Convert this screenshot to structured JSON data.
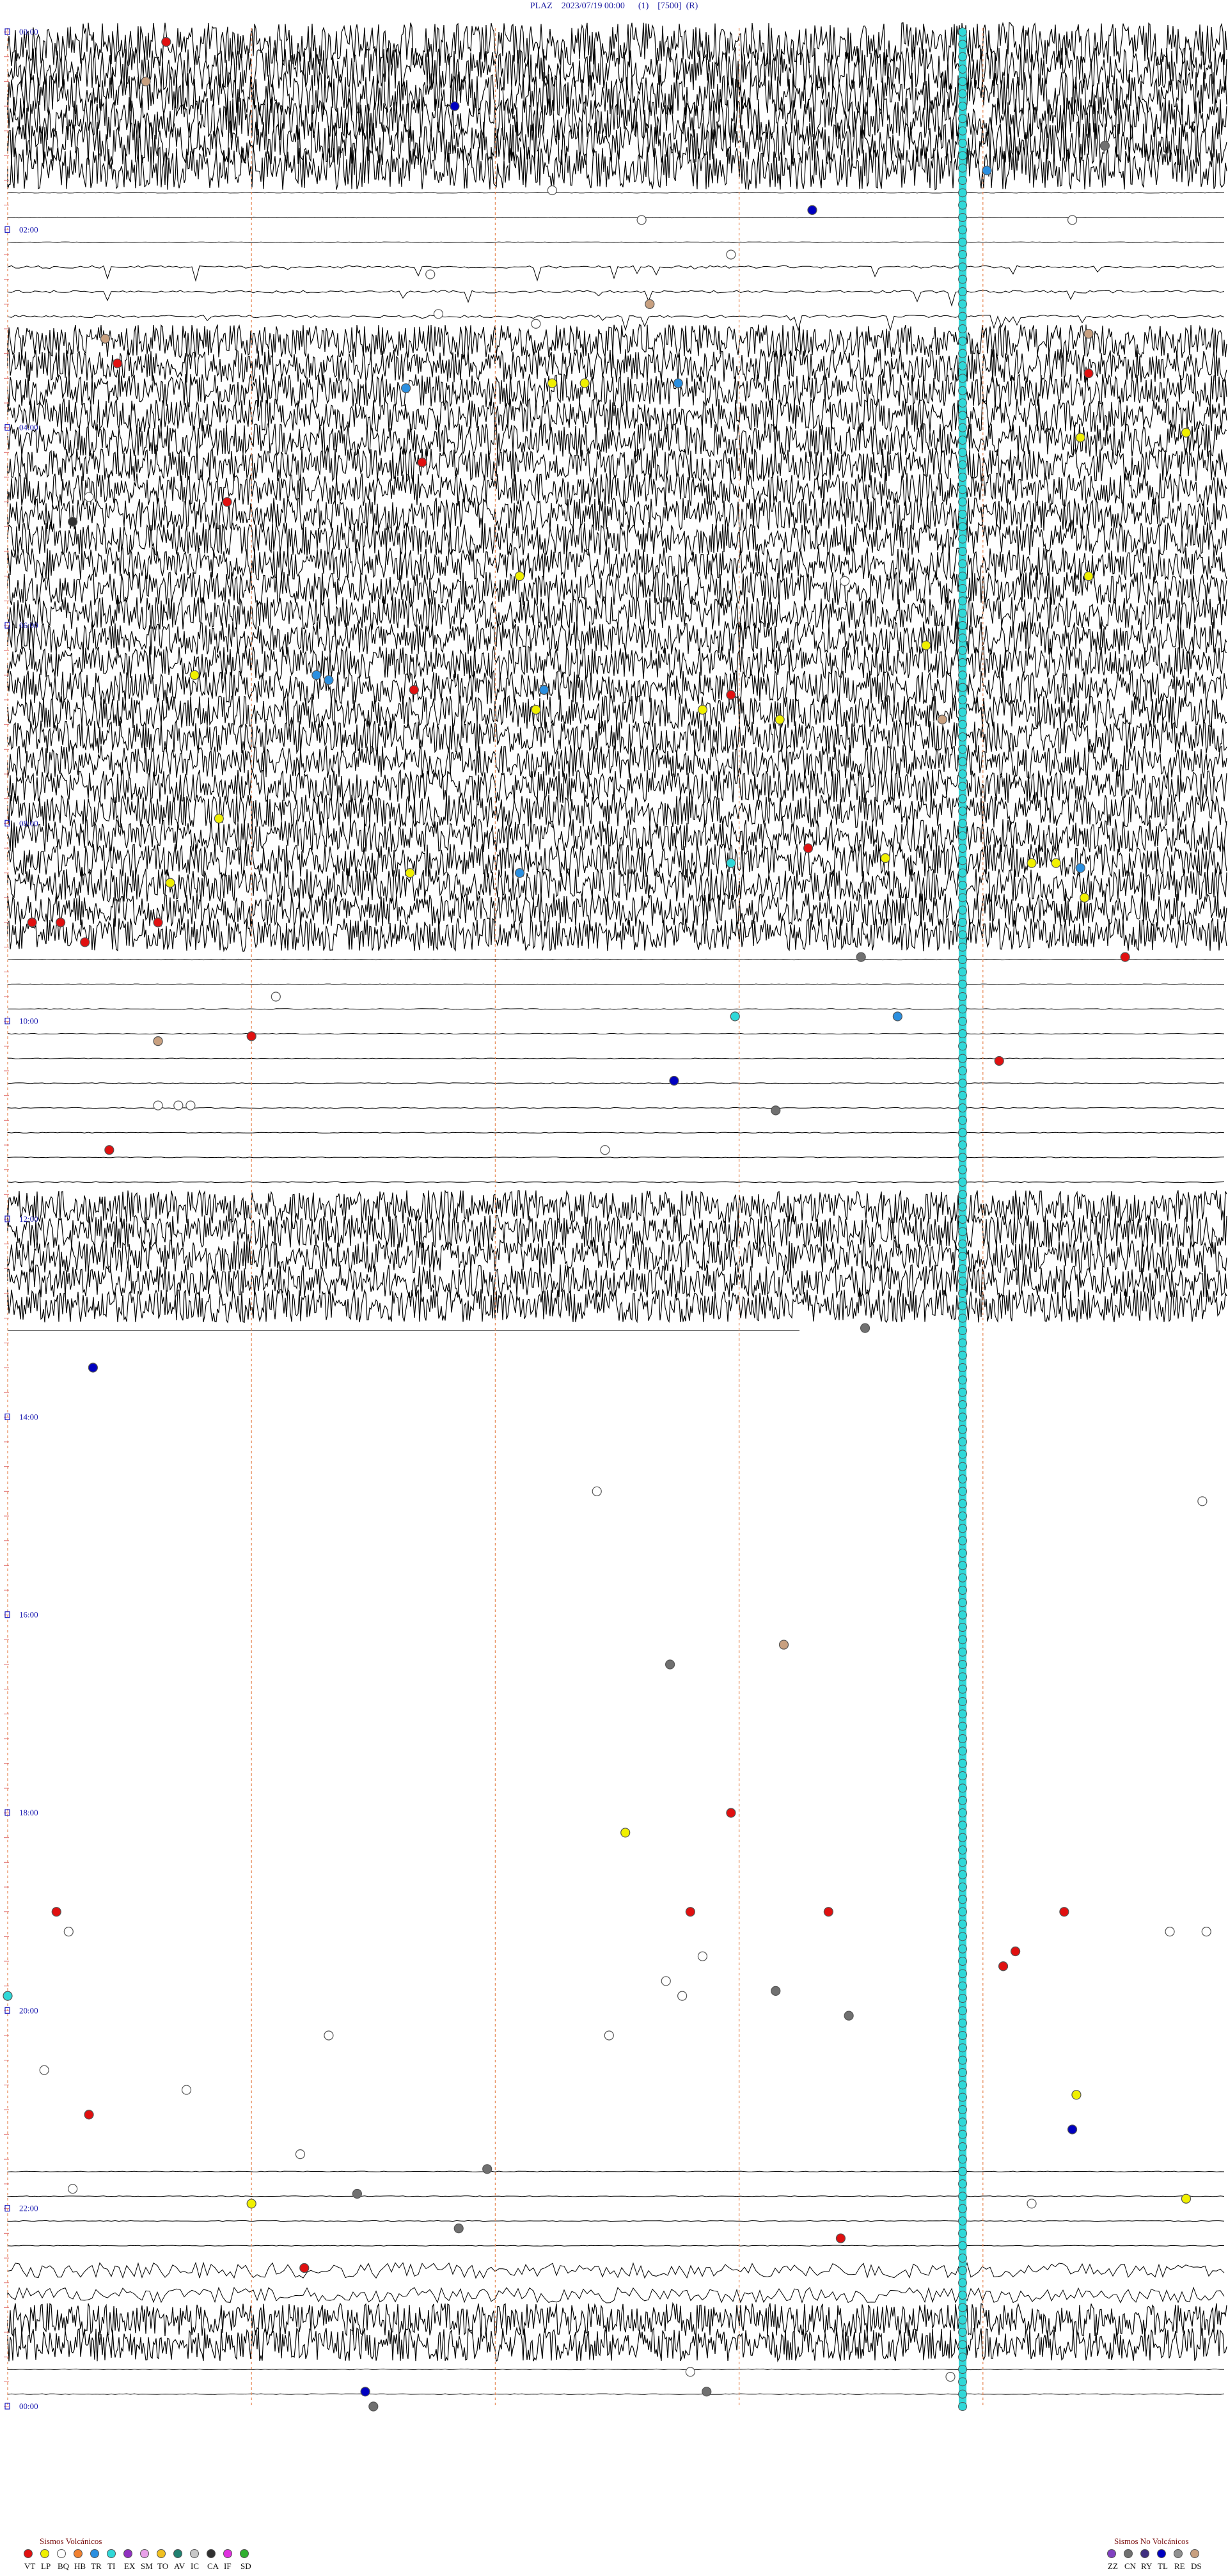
{
  "title": "PLAZ    2023/07/19 00:00      (1)    [7500]  (R)",
  "chart_data": {
    "type": "scatter",
    "title": "PLAZ    2023/07/19 00:00      (1)    [7500]  (R)",
    "station": "PLAZ",
    "date": "2023/07/19 00:00",
    "trace_rows": 96,
    "minutes_per_row": 15,
    "time_labels": [
      "00:00",
      "02:00",
      "04:00",
      "06:00",
      "08:00",
      "10:00",
      "12:00",
      "14:00",
      "16:00",
      "18:00",
      "20:00",
      "22:00",
      "00:00"
    ],
    "ylim_hours": [
      0,
      24
    ],
    "xlim_minutes": [
      0,
      15
    ],
    "minute_markers": [
      0,
      3,
      6,
      9,
      12
    ],
    "continuous_series_minute": 11.75,
    "continuous_series_type": "TI",
    "trace_activity": [
      {
        "from_hour": 0,
        "to_hour": 1.5,
        "level": "saturated"
      },
      {
        "from_hour": 1.5,
        "to_hour": 2.25,
        "level": "quiet"
      },
      {
        "from_hour": 2.25,
        "to_hour": 3.0,
        "level": "spikes"
      },
      {
        "from_hour": 3.0,
        "to_hour": 9.25,
        "level": "noisy"
      },
      {
        "from_hour": 9.25,
        "to_hour": 11.75,
        "level": "quiet"
      },
      {
        "from_hour": 11.75,
        "to_hour": 13.0,
        "level": "noisy"
      },
      {
        "from_hour": 13.0,
        "to_hour": 21.5,
        "level": "flat"
      },
      {
        "from_hour": 21.5,
        "to_hour": 22.5,
        "level": "quiet"
      },
      {
        "from_hour": 22.5,
        "to_hour": 23.0,
        "level": "moderate"
      },
      {
        "from_hour": 23.0,
        "to_hour": 23.5,
        "level": "noisy"
      },
      {
        "from_hour": 23.5,
        "to_hour": 24,
        "level": "quiet"
      }
    ],
    "categories_volcanic": [
      "VT",
      "LP",
      "BQ",
      "HB",
      "TR",
      "TI",
      "EX",
      "SM",
      "TO",
      "AV",
      "IC",
      "CA",
      "IF",
      "SD"
    ],
    "categories_non_volcanic": [
      "ZZ",
      "CN",
      "RY",
      "TL",
      "RE",
      "DS"
    ],
    "category_colors": {
      "VT": "#e01010",
      "LP": "#f0f000",
      "BQ": "#ffffff",
      "HB": "#f08030",
      "TR": "#2a8fe0",
      "TI": "#30d8d8",
      "EX": "#9030c0",
      "SM": "#e8a0e8",
      "TO": "#f0c020",
      "AV": "#208070",
      "IC": "#c8c8c8",
      "CA": "#303030",
      "IF": "#e030e0",
      "SD": "#30b030",
      "ZZ": "#8040c0",
      "CN": "#707070",
      "RY": "#403080",
      "TL": "#0000c0",
      "RE": "#909090",
      "DS": "#c8a080"
    },
    "legend_volcanic_title": "Sismos Volcánicos",
    "legend_non_volcanic_title": "Sismos No Volcánicos",
    "events": [
      {
        "t": 0.1,
        "m": 1.95,
        "c": "VT"
      },
      {
        "t": 0.5,
        "m": 1.7,
        "c": "DS"
      },
      {
        "t": 0.75,
        "m": 5.5,
        "c": "TL"
      },
      {
        "t": 1.15,
        "m": 13.5,
        "c": "CN"
      },
      {
        "t": 1.4,
        "m": 12.05,
        "c": "TR"
      },
      {
        "t": 1.6,
        "m": 6.7,
        "c": "BQ"
      },
      {
        "t": 1.8,
        "m": 9.9,
        "c": "TL"
      },
      {
        "t": 1.9,
        "m": 7.8,
        "c": "BQ"
      },
      {
        "t": 1.9,
        "m": 13.1,
        "c": "BQ"
      },
      {
        "t": 2.25,
        "m": 8.9,
        "c": "BQ"
      },
      {
        "t": 2.45,
        "m": 5.2,
        "c": "BQ"
      },
      {
        "t": 2.75,
        "m": 7.9,
        "c": "DS"
      },
      {
        "t": 2.85,
        "m": 5.3,
        "c": "BQ"
      },
      {
        "t": 2.95,
        "m": 6.5,
        "c": "BQ"
      },
      {
        "t": 3.05,
        "m": 13.3,
        "c": "DS"
      },
      {
        "t": 3.1,
        "m": 1.2,
        "c": "DS"
      },
      {
        "t": 3.35,
        "m": 1.35,
        "c": "VT"
      },
      {
        "t": 3.45,
        "m": 13.3,
        "c": "VT"
      },
      {
        "t": 3.55,
        "m": 6.7,
        "c": "LP"
      },
      {
        "t": 3.55,
        "m": 7.1,
        "c": "LP"
      },
      {
        "t": 3.55,
        "m": 8.25,
        "c": "TR"
      },
      {
        "t": 3.6,
        "m": 4.9,
        "c": "TR"
      },
      {
        "t": 4.05,
        "m": 14.5,
        "c": "LP"
      },
      {
        "t": 4.1,
        "m": 13.2,
        "c": "LP"
      },
      {
        "t": 4.35,
        "m": 5.1,
        "c": "VT"
      },
      {
        "t": 4.7,
        "m": 1.0,
        "c": "BQ"
      },
      {
        "t": 4.75,
        "m": 2.7,
        "c": "VT"
      },
      {
        "t": 4.95,
        "m": 0.8,
        "c": "CA"
      },
      {
        "t": 5.5,
        "m": 6.3,
        "c": "LP"
      },
      {
        "t": 5.5,
        "m": 13.3,
        "c": "LP"
      },
      {
        "t": 5.55,
        "m": 10.3,
        "c": "BQ"
      },
      {
        "t": 6.2,
        "m": 11.3,
        "c": "LP"
      },
      {
        "t": 6.5,
        "m": 2.3,
        "c": "LP"
      },
      {
        "t": 6.5,
        "m": 3.8,
        "c": "TR"
      },
      {
        "t": 6.55,
        "m": 3.95,
        "c": "TR"
      },
      {
        "t": 6.65,
        "m": 5.0,
        "c": "VT"
      },
      {
        "t": 6.65,
        "m": 6.6,
        "c": "TR"
      },
      {
        "t": 6.7,
        "m": 8.9,
        "c": "VT"
      },
      {
        "t": 6.85,
        "m": 6.5,
        "c": "LP"
      },
      {
        "t": 6.85,
        "m": 8.55,
        "c": "LP"
      },
      {
        "t": 6.95,
        "m": 9.5,
        "c": "LP"
      },
      {
        "t": 6.95,
        "m": 11.5,
        "c": "DS"
      },
      {
        "t": 7.95,
        "m": 2.6,
        "c": "LP"
      },
      {
        "t": 8.25,
        "m": 9.85,
        "c": "VT"
      },
      {
        "t": 8.35,
        "m": 10.8,
        "c": "LP"
      },
      {
        "t": 8.4,
        "m": 8.9,
        "c": "TI"
      },
      {
        "t": 8.4,
        "m": 12.6,
        "c": "LP"
      },
      {
        "t": 8.4,
        "m": 12.9,
        "c": "LP"
      },
      {
        "t": 8.45,
        "m": 13.2,
        "c": "TR"
      },
      {
        "t": 8.5,
        "m": 6.3,
        "c": "TR"
      },
      {
        "t": 8.5,
        "m": 4.95,
        "c": "LP"
      },
      {
        "t": 8.6,
        "m": 2.0,
        "c": "LP"
      },
      {
        "t": 8.75,
        "m": 13.25,
        "c": "LP"
      },
      {
        "t": 9.0,
        "m": 0.3,
        "c": "VT"
      },
      {
        "t": 9.0,
        "m": 0.65,
        "c": "VT"
      },
      {
        "t": 9.0,
        "m": 1.85,
        "c": "VT"
      },
      {
        "t": 9.2,
        "m": 0.95,
        "c": "VT"
      },
      {
        "t": 9.35,
        "m": 10.5,
        "c": "CN"
      },
      {
        "t": 9.35,
        "m": 13.75,
        "c": "VT"
      },
      {
        "t": 9.75,
        "m": 3.3,
        "c": "BQ"
      },
      {
        "t": 9.95,
        "m": 8.95,
        "c": "TI"
      },
      {
        "t": 9.95,
        "m": 10.95,
        "c": "TR"
      },
      {
        "t": 10.15,
        "m": 3.0,
        "c": "VT"
      },
      {
        "t": 10.2,
        "m": 1.85,
        "c": "DS"
      },
      {
        "t": 10.4,
        "m": 12.2,
        "c": "VT"
      },
      {
        "t": 10.6,
        "m": 8.2,
        "c": "TL"
      },
      {
        "t": 10.85,
        "m": 1.85,
        "c": "BQ"
      },
      {
        "t": 10.85,
        "m": 2.1,
        "c": "BQ"
      },
      {
        "t": 10.85,
        "m": 2.25,
        "c": "BQ"
      },
      {
        "t": 10.9,
        "m": 9.45,
        "c": "CN"
      },
      {
        "t": 11.3,
        "m": 1.25,
        "c": "VT"
      },
      {
        "t": 11.3,
        "m": 7.35,
        "c": "BQ"
      },
      {
        "t": 13.1,
        "m": 10.55,
        "c": "CN"
      },
      {
        "t": 13.5,
        "m": 1.05,
        "c": "TL"
      },
      {
        "t": 14.75,
        "m": 7.25,
        "c": "BQ"
      },
      {
        "t": 14.85,
        "m": 14.7,
        "c": "BQ"
      },
      {
        "t": 16.3,
        "m": 9.55,
        "c": "DS"
      },
      {
        "t": 16.5,
        "m": 8.15,
        "c": "CN"
      },
      {
        "t": 18.0,
        "m": 8.9,
        "c": "VT"
      },
      {
        "t": 18.2,
        "m": 7.6,
        "c": "LP"
      },
      {
        "t": 19.0,
        "m": 0.6,
        "c": "VT"
      },
      {
        "t": 19.0,
        "m": 8.4,
        "c": "VT"
      },
      {
        "t": 19.0,
        "m": 10.1,
        "c": "VT"
      },
      {
        "t": 19.0,
        "m": 13.0,
        "c": "VT"
      },
      {
        "t": 19.2,
        "m": 0.75,
        "c": "BQ"
      },
      {
        "t": 19.2,
        "m": 14.3,
        "c": "BQ"
      },
      {
        "t": 19.2,
        "m": 14.75,
        "c": "BQ"
      },
      {
        "t": 19.4,
        "m": 12.4,
        "c": "VT"
      },
      {
        "t": 19.45,
        "m": 8.55,
        "c": "BQ"
      },
      {
        "t": 19.55,
        "m": 12.25,
        "c": "VT"
      },
      {
        "t": 19.7,
        "m": 8.1,
        "c": "BQ"
      },
      {
        "t": 19.8,
        "m": 9.45,
        "c": "CN"
      },
      {
        "t": 19.85,
        "m": 8.3,
        "c": "BQ"
      },
      {
        "t": 19.85,
        "m": 0.0,
        "c": "TI"
      },
      {
        "t": 20.05,
        "m": 10.35,
        "c": "CN"
      },
      {
        "t": 20.25,
        "m": 3.95,
        "c": "BQ"
      },
      {
        "t": 20.25,
        "m": 7.4,
        "c": "BQ"
      },
      {
        "t": 20.6,
        "m": 0.45,
        "c": "BQ"
      },
      {
        "t": 20.8,
        "m": 2.2,
        "c": "BQ"
      },
      {
        "t": 20.85,
        "m": 13.15,
        "c": "LP"
      },
      {
        "t": 21.05,
        "m": 1.0,
        "c": "VT"
      },
      {
        "t": 21.2,
        "m": 13.1,
        "c": "TL"
      },
      {
        "t": 21.45,
        "m": 3.6,
        "c": "BQ"
      },
      {
        "t": 21.6,
        "m": 5.9,
        "c": "CN"
      },
      {
        "t": 21.8,
        "m": 0.8,
        "c": "BQ"
      },
      {
        "t": 21.85,
        "m": 4.3,
        "c": "CN"
      },
      {
        "t": 21.95,
        "m": 3.0,
        "c": "LP"
      },
      {
        "t": 21.95,
        "m": 12.6,
        "c": "BQ"
      },
      {
        "t": 21.9,
        "m": 14.5,
        "c": "LP"
      },
      {
        "t": 22.2,
        "m": 5.55,
        "c": "CN"
      },
      {
        "t": 22.3,
        "m": 10.25,
        "c": "VT"
      },
      {
        "t": 22.6,
        "m": 3.65,
        "c": "VT"
      },
      {
        "t": 23.65,
        "m": 8.4,
        "c": "BQ"
      },
      {
        "t": 23.7,
        "m": 11.6,
        "c": "BQ"
      },
      {
        "t": 23.85,
        "m": 4.4,
        "c": "TL"
      },
      {
        "t": 23.85,
        "m": 8.6,
        "c": "CN"
      },
      {
        "t": 24.0,
        "m": 4.5,
        "c": "CN"
      }
    ]
  }
}
